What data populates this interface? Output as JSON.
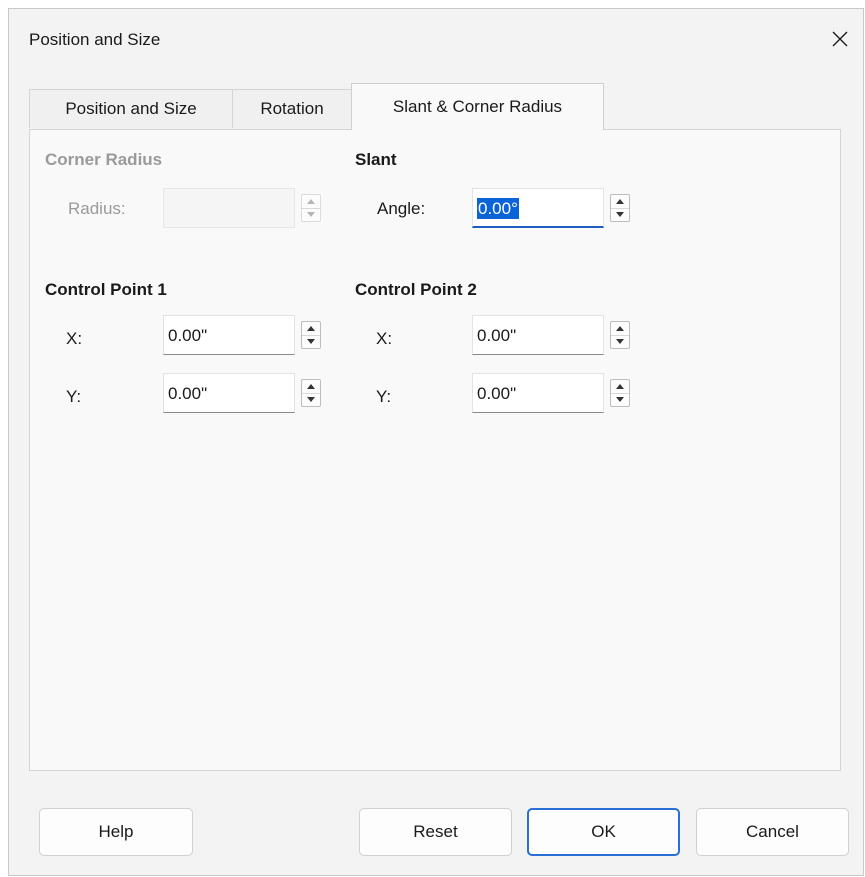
{
  "window": {
    "title": "Position and Size"
  },
  "tabs": [
    {
      "label": "Position and Size"
    },
    {
      "label": "Rotation"
    },
    {
      "label": "Slant & Corner Radius"
    }
  ],
  "corner_radius": {
    "heading": "Corner Radius",
    "radius_label": "Radius:",
    "radius_value": ""
  },
  "slant": {
    "heading": "Slant",
    "angle_label": "Angle:",
    "angle_value": "0.00°"
  },
  "control_point_1": {
    "heading": "Control Point 1",
    "x_label": "X:",
    "x_value": "0.00\"",
    "y_label": "Y:",
    "y_value": "0.00\""
  },
  "control_point_2": {
    "heading": "Control Point 2",
    "x_label": "X:",
    "x_value": "0.00\"",
    "y_label": "Y:",
    "y_value": "0.00\""
  },
  "buttons": {
    "help": "Help",
    "reset": "Reset",
    "ok": "OK",
    "cancel": "Cancel"
  },
  "colors": {
    "accent": "#0a64d8",
    "dialog_bg": "#f3f3f3",
    "disabled_text": "#9a9a9a"
  }
}
